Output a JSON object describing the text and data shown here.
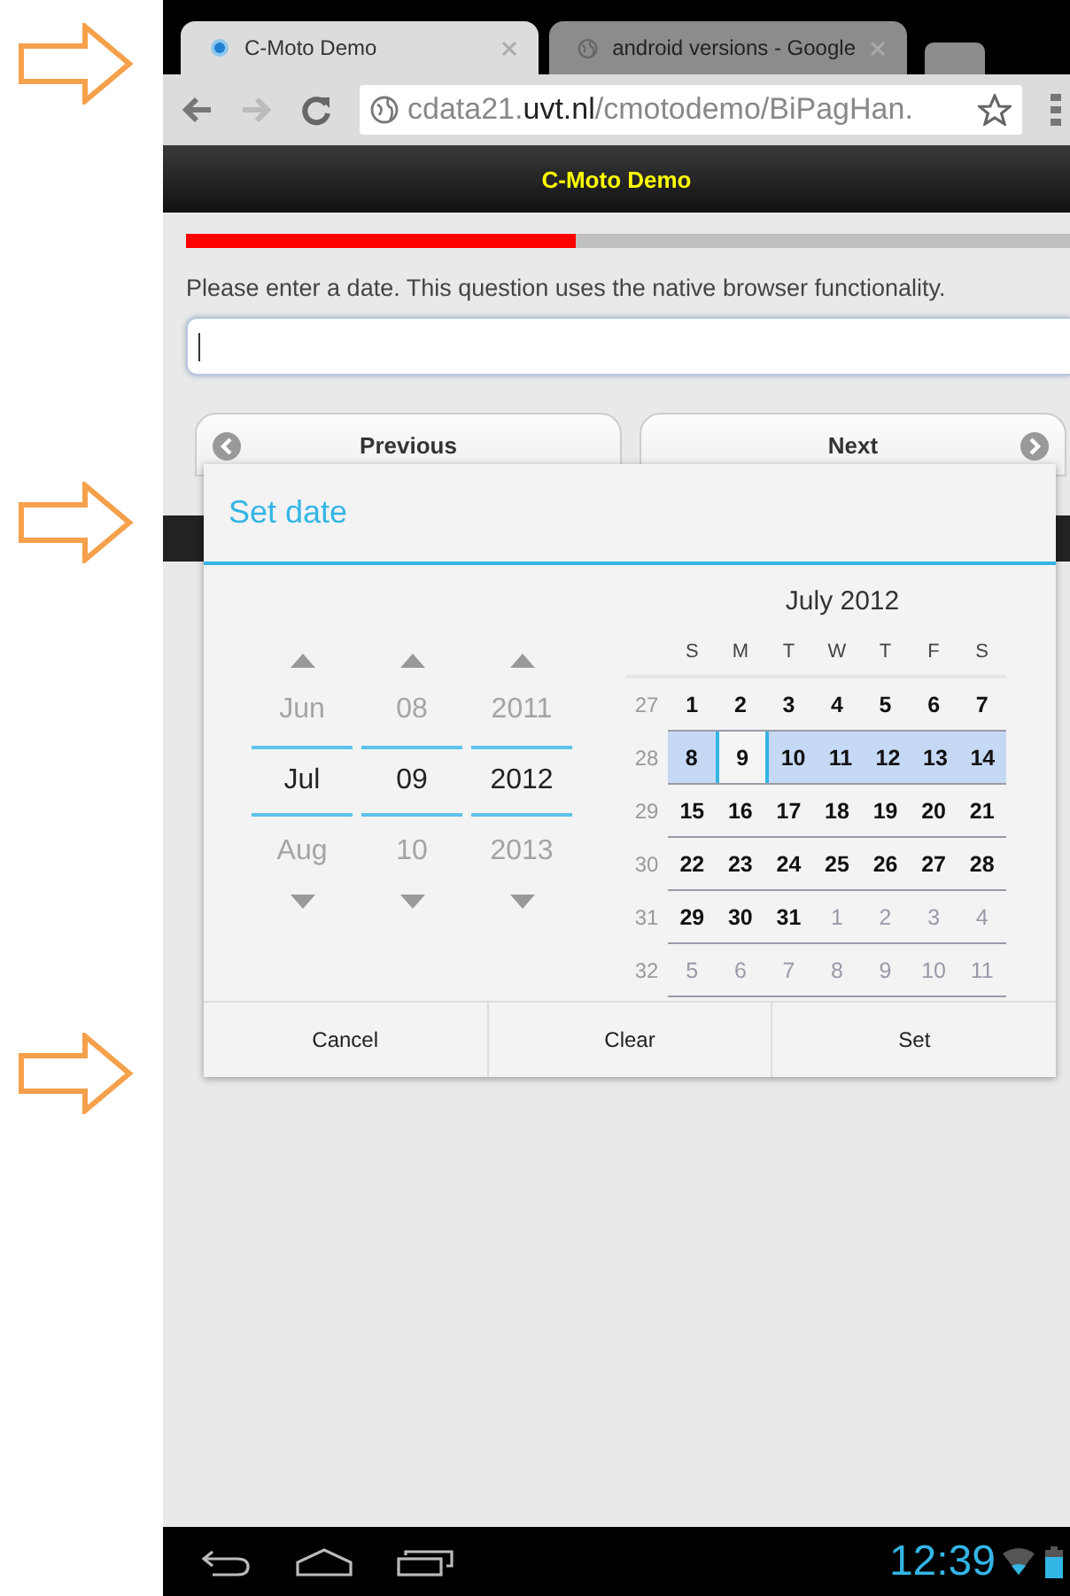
{
  "browser": {
    "tabs": [
      {
        "title": "C-Moto Demo",
        "selected": true,
        "kind": "app"
      },
      {
        "title": "android versions - Google",
        "selected": false,
        "kind": "globe"
      }
    ],
    "url": "cdata21.**uvt.nl**/cmotodemo/BiPagHan."
  },
  "app": {
    "title": "C-Moto Demo",
    "progress": {
      "level": 0.44
    },
    "question": "Please enter a date. This question uses the native browser functionality.",
    "nav": [
      {
        "label": "Previous",
        "kind": "prev"
      },
      {
        "label": "Next",
        "kind": "next"
      }
    ]
  },
  "dialog": {
    "title": "Set date",
    "spinners": [
      {
        "prev": "Jun",
        "current": "Jul",
        "next": "Aug"
      },
      {
        "prev": "08",
        "current": "09",
        "next": "10"
      },
      {
        "prev": "2011",
        "current": "2012",
        "next": "2013"
      }
    ],
    "calendar": {
      "month": "July 2012",
      "weekdays": [
        "S",
        "M",
        "T",
        "W",
        "T",
        "F",
        "S"
      ],
      "weeks": [
        {
          "number": "27",
          "selected": false,
          "days": [
            {
              "day": "1",
              "in_month": true,
              "selected": false
            },
            {
              "day": "2",
              "in_month": true,
              "selected": false
            },
            {
              "day": "3",
              "in_month": true,
              "selected": false
            },
            {
              "day": "4",
              "in_month": true,
              "selected": false
            },
            {
              "day": "5",
              "in_month": true,
              "selected": false
            },
            {
              "day": "6",
              "in_month": true,
              "selected": false
            },
            {
              "day": "7",
              "in_month": true,
              "selected": false
            }
          ]
        },
        {
          "number": "28",
          "selected": true,
          "days": [
            {
              "day": "8",
              "in_month": true,
              "selected": false
            },
            {
              "day": "9",
              "in_month": true,
              "selected": true
            },
            {
              "day": "10",
              "in_month": true,
              "selected": false
            },
            {
              "day": "11",
              "in_month": true,
              "selected": false
            },
            {
              "day": "12",
              "in_month": true,
              "selected": false
            },
            {
              "day": "13",
              "in_month": true,
              "selected": false
            },
            {
              "day": "14",
              "in_month": true,
              "selected": false
            }
          ]
        },
        {
          "number": "29",
          "selected": false,
          "days": [
            {
              "day": "15",
              "in_month": true,
              "selected": false
            },
            {
              "day": "16",
              "in_month": true,
              "selected": false
            },
            {
              "day": "17",
              "in_month": true,
              "selected": false
            },
            {
              "day": "18",
              "in_month": true,
              "selected": false
            },
            {
              "day": "19",
              "in_month": true,
              "selected": false
            },
            {
              "day": "20",
              "in_month": true,
              "selected": false
            },
            {
              "day": "21",
              "in_month": true,
              "selected": false
            }
          ]
        },
        {
          "number": "30",
          "selected": false,
          "days": [
            {
              "day": "22",
              "in_month": true,
              "selected": false
            },
            {
              "day": "23",
              "in_month": true,
              "selected": false
            },
            {
              "day": "24",
              "in_month": true,
              "selected": false
            },
            {
              "day": "25",
              "in_month": true,
              "selected": false
            },
            {
              "day": "26",
              "in_month": true,
              "selected": false
            },
            {
              "day": "27",
              "in_month": true,
              "selected": false
            },
            {
              "day": "28",
              "in_month": true,
              "selected": false
            }
          ]
        },
        {
          "number": "31",
          "selected": false,
          "days": [
            {
              "day": "29",
              "in_month": true,
              "selected": false
            },
            {
              "day": "30",
              "in_month": true,
              "selected": false
            },
            {
              "day": "31",
              "in_month": true,
              "selected": false
            },
            {
              "day": "1",
              "in_month": false,
              "selected": false
            },
            {
              "day": "2",
              "in_month": false,
              "selected": false
            },
            {
              "day": "3",
              "in_month": false,
              "selected": false
            },
            {
              "day": "4",
              "in_month": false,
              "selected": false
            }
          ]
        },
        {
          "number": "32",
          "selected": false,
          "days": [
            {
              "day": "5",
              "in_month": false,
              "selected": false
            },
            {
              "day": "6",
              "in_month": false,
              "selected": false
            },
            {
              "day": "7",
              "in_month": false,
              "selected": false
            },
            {
              "day": "8",
              "in_month": false,
              "selected": false
            },
            {
              "day": "9",
              "in_month": false,
              "selected": false
            },
            {
              "day": "10",
              "in_month": false,
              "selected": false
            },
            {
              "day": "11",
              "in_month": false,
              "selected": false
            }
          ]
        }
      ]
    },
    "buttons": [
      "Cancel",
      "Clear",
      "Set"
    ]
  },
  "status_bar": {
    "time": "12:39"
  }
}
